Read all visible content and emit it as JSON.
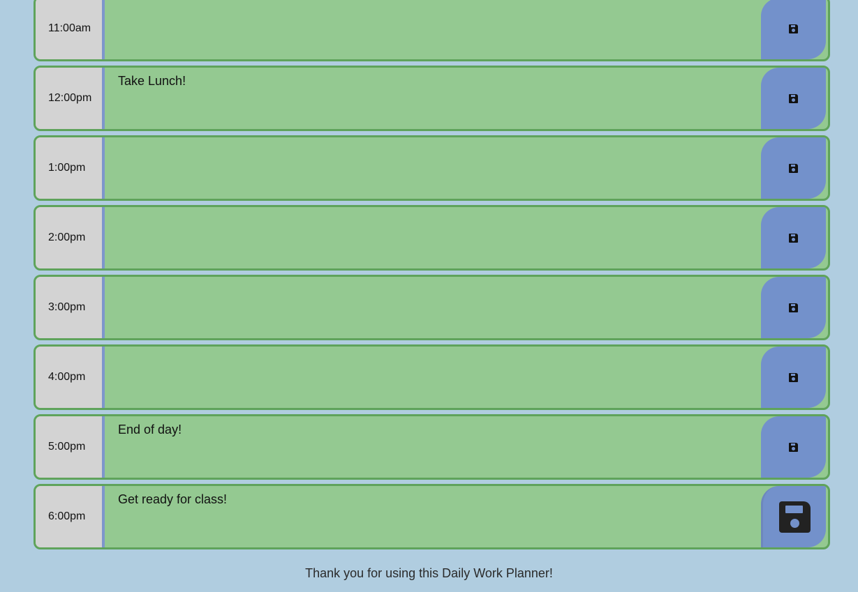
{
  "planner": {
    "rows": [
      {
        "hour": "11:00am",
        "text": ""
      },
      {
        "hour": "12:00pm",
        "text": "Take Lunch!"
      },
      {
        "hour": "1:00pm",
        "text": ""
      },
      {
        "hour": "2:00pm",
        "text": ""
      },
      {
        "hour": "3:00pm",
        "text": ""
      },
      {
        "hour": "4:00pm",
        "text": ""
      },
      {
        "hour": "5:00pm",
        "text": "End of day!"
      },
      {
        "hour": "6:00pm",
        "text": "Get ready for class!"
      }
    ]
  },
  "footer": {
    "text": "Thank you for using this Daily Work Planner!"
  },
  "colors": {
    "background": "#b0cde0",
    "row_fill": "#94c991",
    "row_border": "#5fa35b",
    "hour_fill": "#d3d3d3",
    "save_button": "#7391cb"
  },
  "icons": {
    "save": "floppy-disk-icon"
  }
}
